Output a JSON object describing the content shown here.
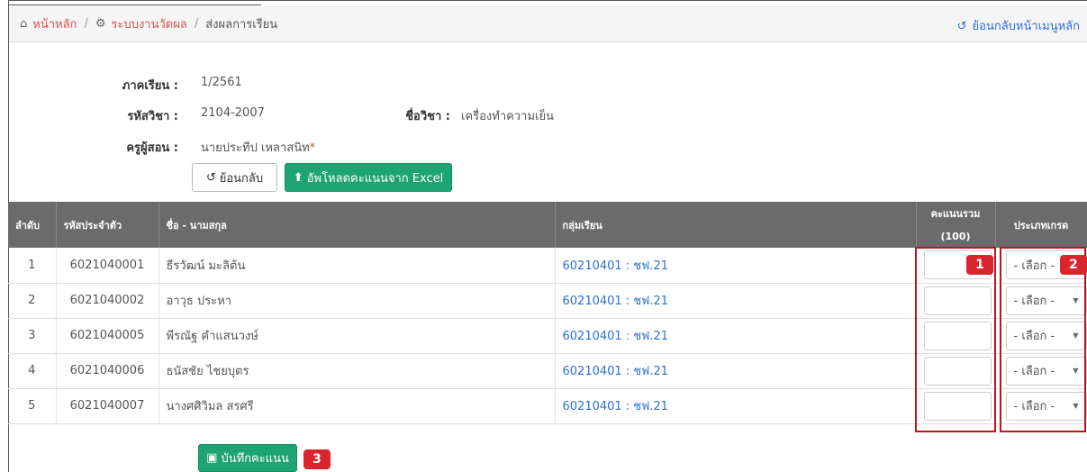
{
  "breadcrumb": {
    "home": "หน้าหลัก",
    "system": "ระบบงานวัดผล",
    "current": "ส่งผลการเรียน",
    "back_main": "ย้อนกลับหน้าเมนูหลัก"
  },
  "info": {
    "term_label": "ภาคเรียน :",
    "term_value": "1/2561",
    "code_label": "รหัสวิชา :",
    "code_value": "2104-2007",
    "name_label": "ชื่อวิชา :",
    "name_value": "เครื่องทำความเย็น",
    "teacher_label": "ครูผู้สอน :",
    "teacher_value": "นายประทีป เหลาสนิท",
    "teacher_mark": "*"
  },
  "buttons": {
    "back": "ย้อนกลับ",
    "upload": "อัพโหลดคะแนนจาก Excel",
    "save": "บันทึกคะแนน"
  },
  "table": {
    "headers": {
      "no": "ลำดับ",
      "id": "รหัสประจำตัว",
      "name": "ชื่อ - นามสกุล",
      "group": "กลุ่มเรียน",
      "score": "คะแนนรวม",
      "score_max": "(100)",
      "grade_type": "ประเภทเกรด"
    },
    "rows": [
      {
        "no": "1",
        "id": "6021040001",
        "name": "ธีรวัฒน์ มะลิต้น",
        "group": "60210401 : ชฟ.21",
        "grade": "- เลือก -"
      },
      {
        "no": "2",
        "id": "6021040002",
        "name": "อาวุธ ประหา",
        "group": "60210401 : ชฟ.21",
        "grade": "- เลือก -"
      },
      {
        "no": "3",
        "id": "6021040005",
        "name": "พีรณัฐ คำแสนวงษ์",
        "group": "60210401 : ชฟ.21",
        "grade": "- เลือก -"
      },
      {
        "no": "4",
        "id": "6021040006",
        "name": "ธนัสชัย ไชยบุตร",
        "group": "60210401 : ชฟ.21",
        "grade": "- เลือก -"
      },
      {
        "no": "5",
        "id": "6021040007",
        "name": "นางศศิวิมล สรศรี",
        "group": "60210401 : ชฟ.21",
        "grade": "- เลือก -"
      }
    ]
  },
  "badges": [
    "1",
    "2",
    "3"
  ],
  "colors": {
    "accent_green": "#1ea372",
    "link_blue": "#2a6fd6",
    "highlight_red": "#c0141c",
    "header_gray": "#6b6b6b"
  }
}
